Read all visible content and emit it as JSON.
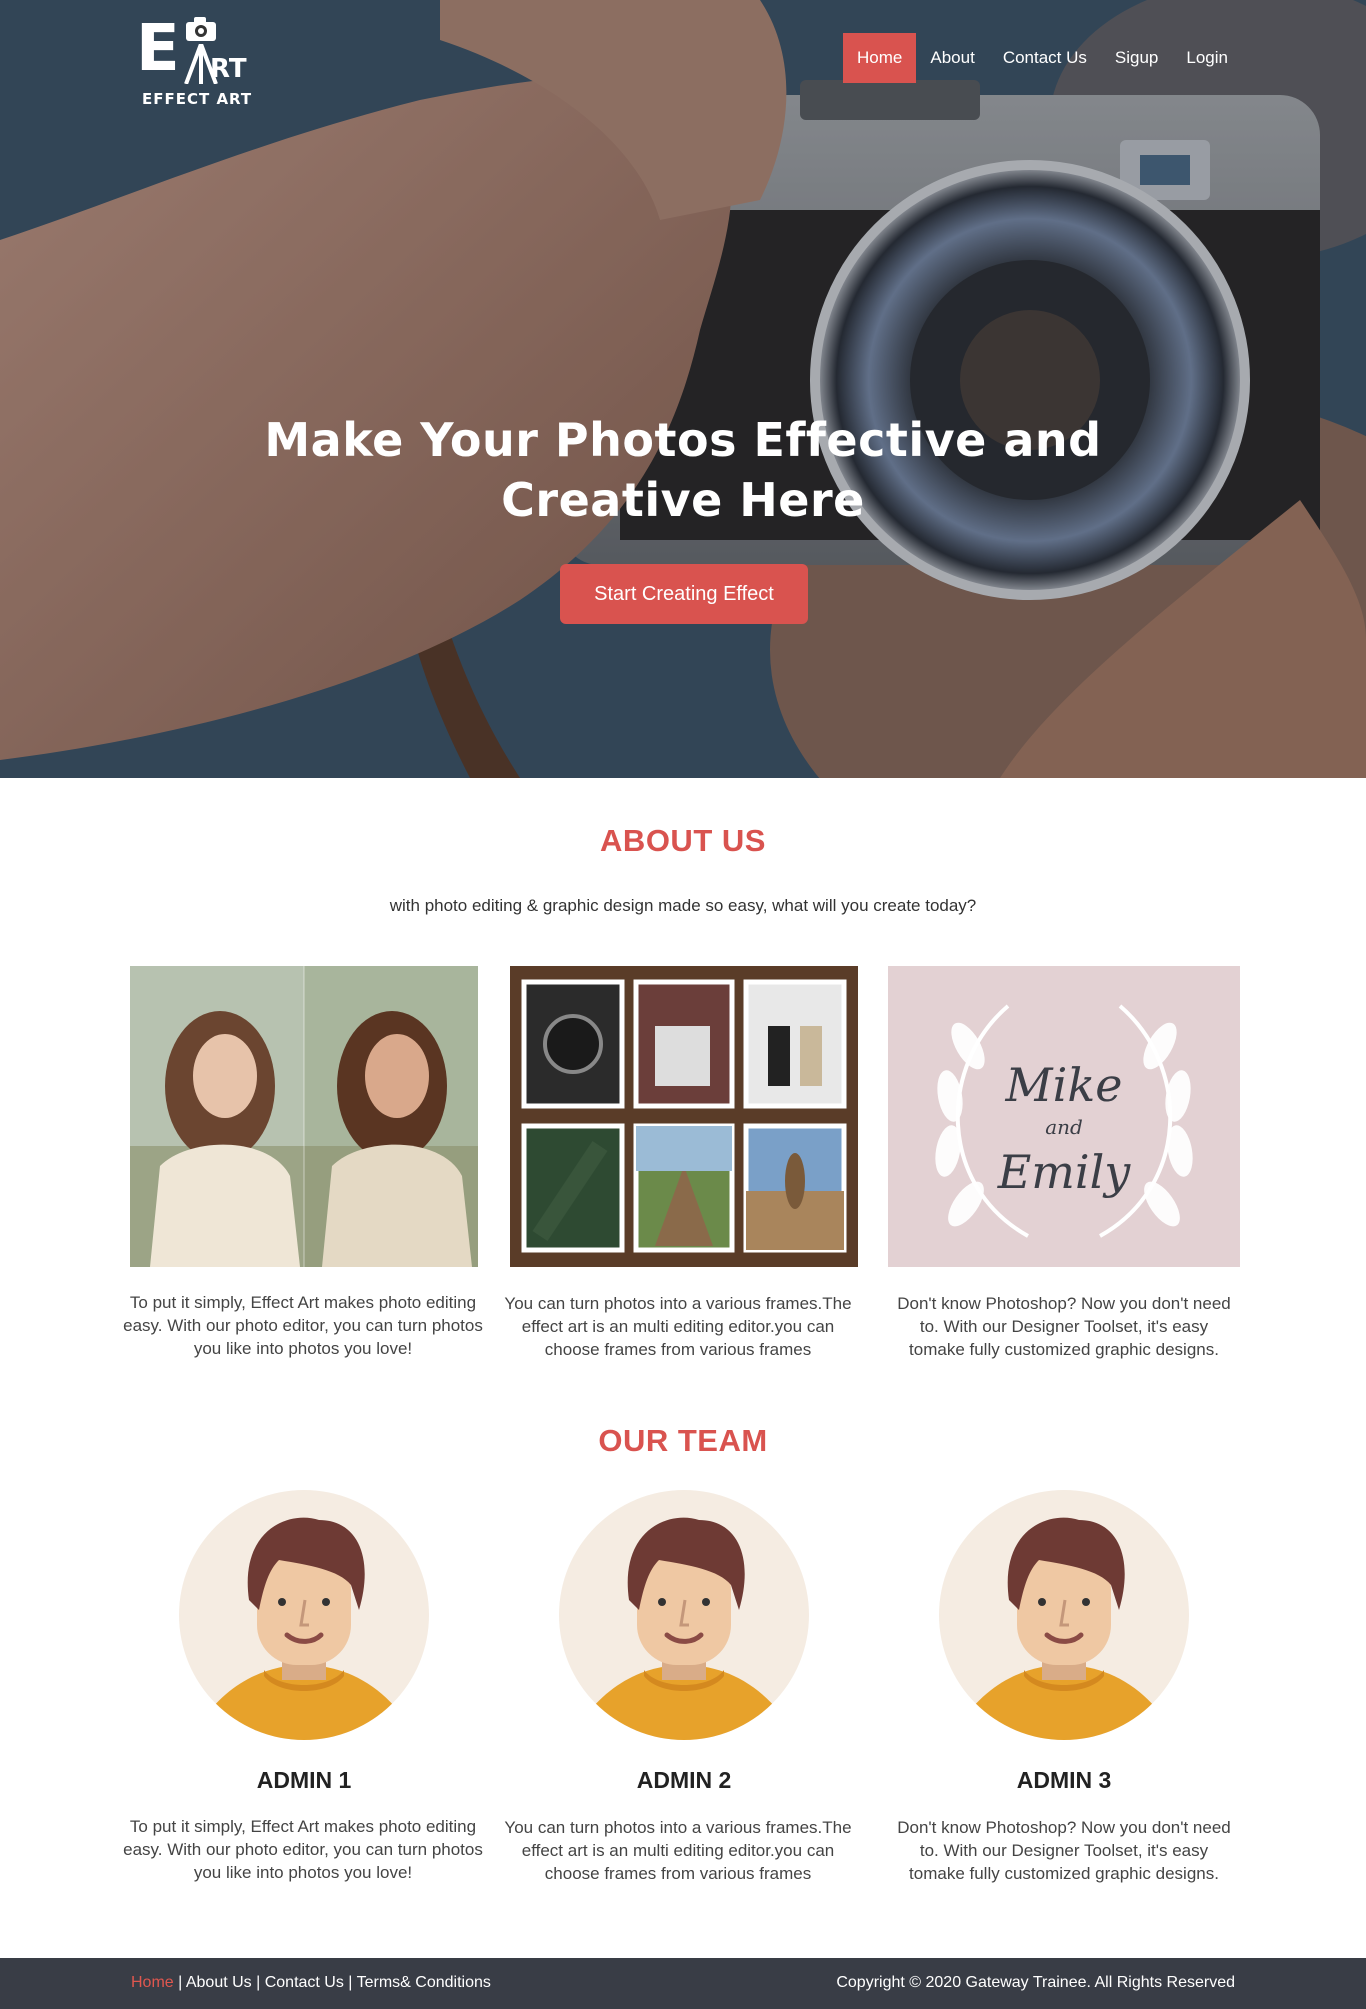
{
  "brand": {
    "logo_letters": "E",
    "logo_letters2": "RT",
    "logo_tagline": "EFFECT ART"
  },
  "nav": {
    "items": [
      {
        "label": "Home",
        "active": true
      },
      {
        "label": "About",
        "active": false
      },
      {
        "label": "Contact Us",
        "active": false
      },
      {
        "label": "Sigup",
        "active": false
      },
      {
        "label": "Login",
        "active": false
      }
    ]
  },
  "hero": {
    "title": "Make Your Photos Effective and Creative Here",
    "cta_label": "Start Creating Effect"
  },
  "about": {
    "title": "ABOUT US",
    "subtitle": "with photo editing & graphic design made so easy, what will you create today?",
    "cards": [
      {
        "image": "before-after-portrait",
        "text": "To put it simply, Effect Art makes photo editing easy. With our photo editor, you can turn photos you like into photos you love!"
      },
      {
        "image": "photo-frames-collage",
        "text": "You can turn photos into a various frames.The effect art is an multi editing editor.you can choose frames from various frames"
      },
      {
        "image": "wedding-invitation-design",
        "text": "Don't know Photoshop? Now you don't need to. With our Designer Toolset, it's easy tomake fully customized graphic designs."
      }
    ],
    "design_script_line1": "Mike",
    "design_script_line2": "and",
    "design_script_line3": "Emily"
  },
  "team": {
    "title": "OUR TEAM",
    "members": [
      {
        "name": "ADMIN 1",
        "text": "To put it simply, Effect Art makes photo editing easy. With our photo editor, you can turn photos you like into photos you love!"
      },
      {
        "name": "ADMIN 2",
        "text": "You can turn photos into a various frames.The effect art is an multi editing editor.you can choose frames from various frames"
      },
      {
        "name": "ADMIN 3",
        "text": "Don't know Photoshop? Now you don't need to. With our Designer Toolset, it's easy tomake fully customized graphic designs."
      }
    ]
  },
  "footer": {
    "links": [
      "Home",
      "About Us",
      "Contact Us",
      "Terms& Conditions"
    ],
    "separator": " | ",
    "copyright": "Copyright © 2020 Gateway Trainee. All Rights Reserved"
  },
  "colors": {
    "accent": "#d9534f",
    "footer_bg": "#393d46",
    "avatar_bg": "#f5ece2"
  }
}
